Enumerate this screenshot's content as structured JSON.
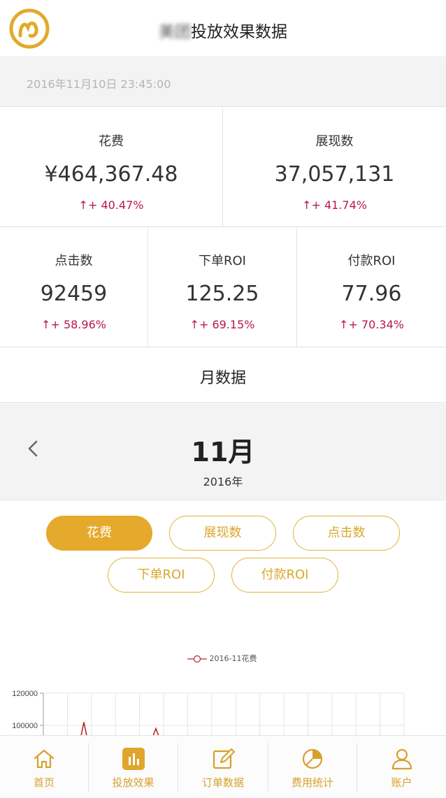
{
  "header": {
    "title_blurred": "美团",
    "title": "投放效果数据"
  },
  "timestamp": "2016年11月10日 23:45:00",
  "stats": [
    {
      "label": "花费",
      "value": "¥464,367.48",
      "change": "↑+ 40.47%"
    },
    {
      "label": "展现数",
      "value": "37,057,131",
      "change": "↑+ 41.74%"
    },
    {
      "label": "点击数",
      "value": "92459",
      "change": "↑+ 58.96%"
    },
    {
      "label": "下单ROI",
      "value": "125.25",
      "change": "↑+ 69.15%"
    },
    {
      "label": "付款ROI",
      "value": "77.96",
      "change": "↑+ 70.34%"
    }
  ],
  "month_section": {
    "title": "月数据",
    "month": "11月",
    "year": "2016年"
  },
  "metric_buttons": [
    {
      "label": "花费",
      "active": true
    },
    {
      "label": "展现数",
      "active": false
    },
    {
      "label": "点击数",
      "active": false
    },
    {
      "label": "下单ROI",
      "active": false
    },
    {
      "label": "付款ROI",
      "active": false
    }
  ],
  "colors": {
    "accent": "#e5a92b",
    "positive_change": "#b8164e",
    "chart_line": "#b52a2a"
  },
  "chart_data": {
    "type": "line",
    "legend": [
      "2016-11花费"
    ],
    "y_ticks": [
      "120000",
      "100000"
    ],
    "grid": true,
    "series": [
      {
        "name": "2016-11花费",
        "values": [
          null,
          102000,
          null,
          98000,
          null
        ]
      }
    ]
  },
  "tabbar": {
    "items": [
      {
        "label": "首页",
        "icon": "home-icon",
        "active": false
      },
      {
        "label": "投放效果",
        "icon": "bar-chart-icon",
        "active": true
      },
      {
        "label": "订单数据",
        "icon": "edit-icon",
        "active": false
      },
      {
        "label": "费用统计",
        "icon": "pie-chart-icon",
        "active": false
      },
      {
        "label": "账户",
        "icon": "user-icon",
        "active": false
      }
    ]
  }
}
